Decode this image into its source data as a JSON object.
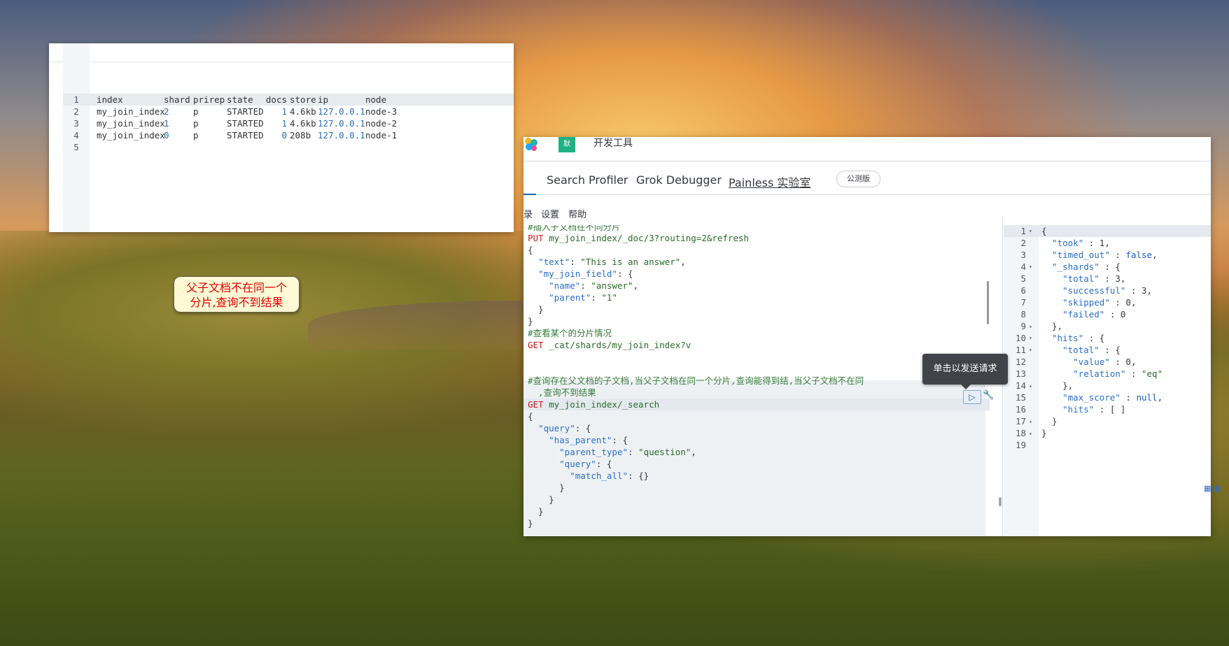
{
  "cat_window": {
    "header": "index         shard prirep state   docs store ip        node",
    "rows": [
      {
        "ln": "1",
        "index": "index        ",
        "shard": "shard",
        "prirep": "prirep",
        "state": "state  ",
        "docs": " docs",
        "store": "store",
        "ip": "ip       ",
        "node": "node"
      },
      {
        "ln": "2",
        "index": "my_join_index",
        "shard": "2",
        "prirep": "p",
        "state": "STARTED",
        "docs": "1",
        "store": "4.6kb",
        "ip": "127.0.0.1",
        "node": "node-3"
      },
      {
        "ln": "3",
        "index": "my_join_index",
        "shard": "1",
        "prirep": "p",
        "state": "STARTED",
        "docs": "1",
        "store": "4.6kb",
        "ip": "127.0.0.1",
        "node": "node-2"
      },
      {
        "ln": "4",
        "index": "my_join_index",
        "shard": "0",
        "prirep": "p",
        "state": "STARTED",
        "docs": "0",
        "store": "208b",
        "ip": "127.0.0.1",
        "node": "node-1"
      },
      {
        "ln": "5"
      }
    ]
  },
  "callout": {
    "line1": "父子文档不在同一个",
    "line2": "分片,查询不到结果"
  },
  "kibana": {
    "badge": "默",
    "app_title": "开发工具",
    "tabs": [
      "Search Profiler",
      "Grok Debugger",
      "Painless 实验室"
    ],
    "beta": "公测版",
    "menu": [
      "录",
      "设置",
      "帮助"
    ],
    "tooltip": "单击以发送请求",
    "run_icon": "▷",
    "wrench_icon": "🔧",
    "divider_handle": "‖"
  },
  "request_lines": [
    {
      "t": "comment",
      "v": "#插入子文档在不同分片"
    },
    {
      "t": "method",
      "m": "PUT",
      "u": " my_join_index/_doc/3?routing=2&refresh"
    },
    {
      "t": "plain",
      "v": "{"
    },
    {
      "t": "kv",
      "v": "  \"text\": \"This is an answer\","
    },
    {
      "t": "kv",
      "v": "  \"my_join_field\": {"
    },
    {
      "t": "kv",
      "v": "    \"name\": \"answer\","
    },
    {
      "t": "kv",
      "v": "    \"parent\": \"1\""
    },
    {
      "t": "plain",
      "v": "  }"
    },
    {
      "t": "plain",
      "v": "}"
    },
    {
      "t": "comment",
      "v": "#查看某个的分片情况"
    },
    {
      "t": "method",
      "m": "GET",
      "u": " _cat/shards/my_join_index?v"
    },
    {
      "t": "plain",
      "v": ""
    },
    {
      "t": "plain",
      "v": ""
    },
    {
      "t": "comment",
      "v": "#查询存在父文档的子文档,当父子文档在同一个分片,查询能得到结,当父子文档不在同"
    },
    {
      "t": "comment",
      "v": "  ,查询不到结果"
    },
    {
      "t": "method",
      "m": "GET",
      "u": " my_join_index/_search"
    },
    {
      "t": "plain",
      "v": "{"
    },
    {
      "t": "kv",
      "v": "  \"query\": {"
    },
    {
      "t": "kv",
      "v": "    \"has_parent\": {"
    },
    {
      "t": "kv",
      "v": "      \"parent_type\": \"question\","
    },
    {
      "t": "kv",
      "v": "      \"query\": {"
    },
    {
      "t": "kv",
      "v": "        \"match_all\": {}"
    },
    {
      "t": "plain",
      "v": "      }"
    },
    {
      "t": "plain",
      "v": "    }"
    },
    {
      "t": "plain",
      "v": "  }"
    },
    {
      "t": "plain",
      "v": "}"
    }
  ],
  "response_lines": [
    {
      "ln": "1",
      "f": "▾",
      "v": "{"
    },
    {
      "ln": "2",
      "f": "",
      "v": "  \"took\" : 1,"
    },
    {
      "ln": "3",
      "f": "",
      "v": "  \"timed_out\" : false,"
    },
    {
      "ln": "4",
      "f": "▾",
      "v": "  \"_shards\" : {"
    },
    {
      "ln": "5",
      "f": "",
      "v": "    \"total\" : 3,"
    },
    {
      "ln": "6",
      "f": "",
      "v": "    \"successful\" : 3,"
    },
    {
      "ln": "7",
      "f": "",
      "v": "    \"skipped\" : 0,"
    },
    {
      "ln": "8",
      "f": "",
      "v": "    \"failed\" : 0"
    },
    {
      "ln": "9",
      "f": "▴",
      "v": "  },"
    },
    {
      "ln": "10",
      "f": "▾",
      "v": "  \"hits\" : {"
    },
    {
      "ln": "11",
      "f": "▾",
      "v": "    \"total\" : {"
    },
    {
      "ln": "12",
      "f": "",
      "v": "      \"value\" : 0,"
    },
    {
      "ln": "13",
      "f": "",
      "v": "      \"relation\" : \"eq\""
    },
    {
      "ln": "14",
      "f": "▴",
      "v": "    },"
    },
    {
      "ln": "15",
      "f": "",
      "v": "    \"max_score\" : null,"
    },
    {
      "ln": "16",
      "f": "",
      "v": "    \"hits\" : [ ]"
    },
    {
      "ln": "17",
      "f": "▴",
      "v": "  }"
    },
    {
      "ln": "18",
      "f": "▴",
      "v": "}"
    },
    {
      "ln": "19",
      "f": "",
      "v": ""
    }
  ]
}
